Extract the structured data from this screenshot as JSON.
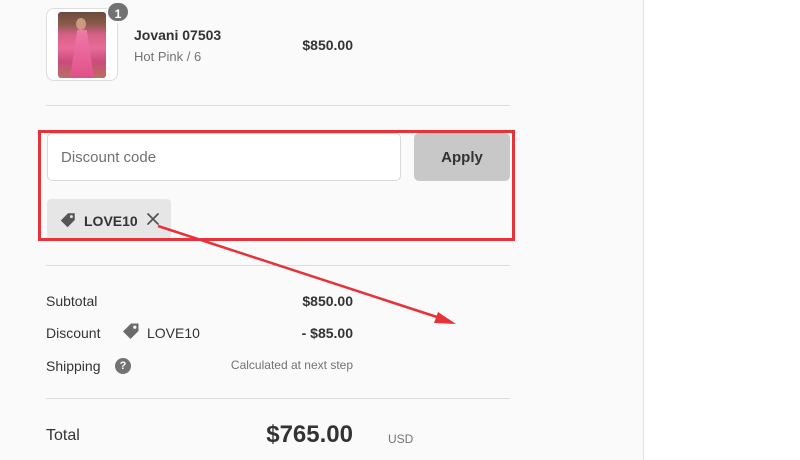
{
  "product": {
    "title": "Jovani 07503",
    "variant": "Hot Pink / 6",
    "price": "$850.00",
    "quantity": "1"
  },
  "discount": {
    "placeholder": "Discount code",
    "value": "",
    "apply_label": "Apply",
    "applied_code": "LOVE10"
  },
  "totals": {
    "subtotal_label": "Subtotal",
    "subtotal_value": "$850.00",
    "discount_label": "Discount",
    "discount_code": "LOVE10",
    "discount_value": "- $85.00",
    "shipping_label": "Shipping",
    "shipping_help": "?",
    "shipping_value": "Calculated at next step",
    "total_label": "Total",
    "currency": "USD",
    "total_value": "$765.00"
  },
  "icons": {
    "tag": "tag-icon",
    "remove": "close-icon",
    "help": "question-circle-icon"
  },
  "colors": {
    "annotation": "#e8323a",
    "chip_bg": "#e6e6e6",
    "apply_bg": "#c8c8c8",
    "panel_bg": "#fafafa",
    "badge_bg": "#727272"
  }
}
